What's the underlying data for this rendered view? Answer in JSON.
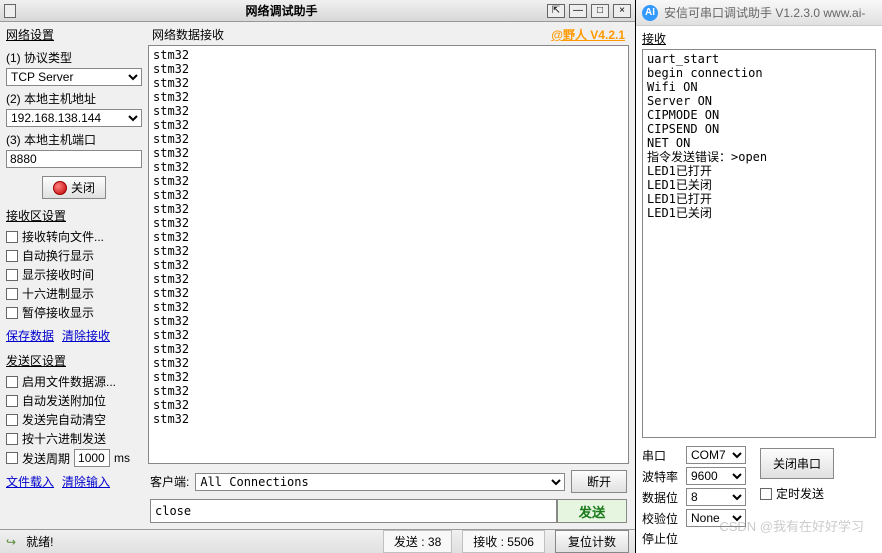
{
  "left": {
    "title": "网络调试助手",
    "watermark": "@野人 V4.2.1",
    "netSettings": {
      "title": "网络设置",
      "protoLabel": "(1) 协议类型",
      "protoValue": "TCP Server",
      "hostLabel": "(2) 本地主机地址",
      "hostValue": "192.168.138.144",
      "portLabel": "(3) 本地主机端口",
      "portValue": "8880",
      "closeBtn": "关闭"
    },
    "rxSettings": {
      "title": "接收区设置",
      "items": [
        "接收转向文件...",
        "自动换行显示",
        "显示接收时间",
        "十六进制显示",
        "暂停接收显示"
      ],
      "links": [
        "保存数据",
        "清除接收"
      ]
    },
    "txSettings": {
      "title": "发送区设置",
      "items": [
        "启用文件数据源...",
        "自动发送附加位",
        "发送完自动清空",
        "按十六进制发送"
      ],
      "periodLabel": "发送周期",
      "periodValue": "1000",
      "periodUnit": "ms",
      "links": [
        "文件载入",
        "清除输入"
      ]
    },
    "dataRxLabel": "网络数据接收",
    "rxLines": [
      "stm32",
      "stm32",
      "stm32",
      "stm32",
      "stm32",
      "stm32",
      "stm32",
      "stm32",
      "stm32",
      "stm32",
      "stm32",
      "stm32",
      "stm32",
      "stm32",
      "stm32",
      "stm32",
      "stm32",
      "stm32",
      "stm32",
      "stm32",
      "stm32",
      "stm32",
      "stm32",
      "stm32",
      "stm32",
      "stm32",
      "stm32"
    ],
    "clientLabel": "客户端:",
    "clientValue": "All Connections",
    "disconnectBtn": "断开",
    "txValue": "close",
    "sendBtn": "发送",
    "status": {
      "ready": "就绪!",
      "txCount": "发送 : 38",
      "rxCount": "接收 : 5506",
      "resetBtn": "复位计数"
    }
  },
  "right": {
    "title": "安信可串口调试助手 V1.2.3.0     www.ai-",
    "rxLabel": "接收",
    "rxLines": [
      "uart_start",
      "begin connection",
      "Wifi ON",
      "Server ON",
      "CIPMODE ON",
      "CIPSEND ON",
      "NET ON",
      "指令发送错误：>open",
      "LED1已打开",
      "LED1已关闭",
      "LED1已打开",
      "LED1已关闭"
    ],
    "params": {
      "serialLabel": "串口",
      "serialValue": "COM7",
      "baudLabel": "波特率",
      "baudValue": "9600",
      "dataLabel": "数据位",
      "dataValue": "8",
      "parityLabel": "校验位",
      "parityValue": "None",
      "stopLabel": "停止位"
    },
    "closeSerialBtn": "关闭串口",
    "timedSend": "定时发送",
    "bottomWatermark": "CSDN @我有在好好学习"
  }
}
